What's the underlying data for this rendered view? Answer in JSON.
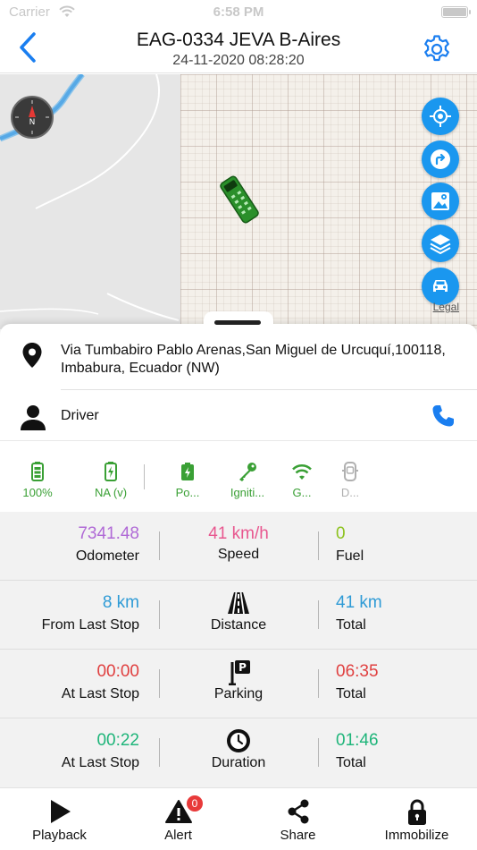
{
  "status_bar": {
    "carrier": "Carrier",
    "time": "6:58 PM"
  },
  "header": {
    "title": "EAG-0334 JEVA B-Aires",
    "subtitle": "24-11-2020 08:28:20",
    "back_icon": "chevron-left-icon",
    "settings_icon": "gear-icon"
  },
  "map": {
    "legal_label": "Legal",
    "compass_label": "N",
    "buttons": [
      "locate-icon",
      "directions-icon",
      "map-pin-image-icon",
      "layers-icon",
      "car-icon"
    ],
    "accent_color": "#1a97ef"
  },
  "address": {
    "text": "Via Tumbabiro  Pablo Arenas,San Miguel de Urcuquí,100118, Imbabura, Ecuador (NW)"
  },
  "driver": {
    "label": "Driver"
  },
  "sensors": [
    {
      "icon": "battery-icon",
      "label": "100%"
    },
    {
      "icon": "battery-charging-icon",
      "label": "NA (v)"
    },
    {
      "icon": "power-icon",
      "label": "Po..."
    },
    {
      "icon": "ignition-key-icon",
      "label": "Igniti..."
    },
    {
      "icon": "gps-signal-icon",
      "label": "G..."
    },
    {
      "icon": "door-icon",
      "label": "D..."
    }
  ],
  "stats": {
    "odometer": {
      "value": "7341.48",
      "label": "Odometer",
      "color": "#b06ad6"
    },
    "speed": {
      "value": "41 km/h",
      "label": "Speed",
      "color": "#e8578f"
    },
    "fuel": {
      "value": "0",
      "label": "Fuel",
      "color": "#8cc21d"
    },
    "from_last_stop": {
      "value": "8 km",
      "label": "From Last Stop",
      "color": "#2f9bd6"
    },
    "distance": {
      "label": "Distance"
    },
    "total_distance": {
      "value": "41 km",
      "label": "Total",
      "color": "#2f9bd6"
    },
    "parking_last_stop": {
      "value": "00:00",
      "label": "At Last Stop",
      "color": "#e04040"
    },
    "parking": {
      "label": "Parking"
    },
    "parking_total": {
      "value": "06:35",
      "label": "Total",
      "color": "#e04040"
    },
    "duration_last_stop": {
      "value": "00:22",
      "label": "At Last Stop",
      "color": "#1fb57a"
    },
    "duration": {
      "label": "Duration"
    },
    "duration_total": {
      "value": "01:46",
      "label": "Total",
      "color": "#1fb57a"
    }
  },
  "tabs": [
    {
      "label": "Playback",
      "icon": "play-icon"
    },
    {
      "label": "Alert",
      "icon": "alert-icon",
      "badge": "0"
    },
    {
      "label": "Share",
      "icon": "share-icon"
    },
    {
      "label": "Immobilize",
      "icon": "lock-icon"
    }
  ]
}
